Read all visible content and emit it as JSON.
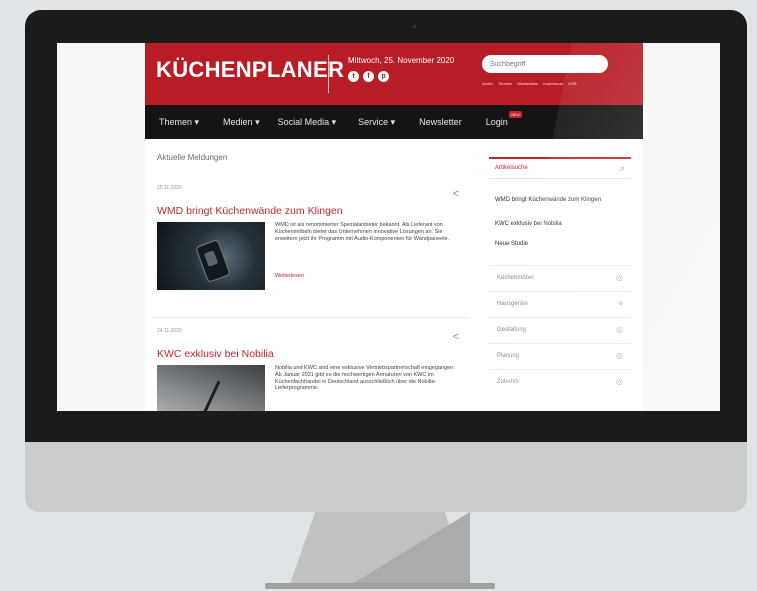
{
  "site": {
    "logo": "KÜCHENPLANER",
    "date": "Mittwoch, 25. November 2020",
    "social_icons": [
      "twitter-icon",
      "facebook-icon",
      "pinterest-icon"
    ],
    "search_placeholder": "Suchbegriff",
    "header_links": [
      "Archiv",
      "Termine",
      "Mediadaten",
      "Impressum",
      "AGB"
    ],
    "nav": [
      {
        "label": "Themen ▾"
      },
      {
        "label": "Medien ▾"
      },
      {
        "label": "Social Media ▾"
      },
      {
        "label": "Service ▾"
      },
      {
        "label": "Newsletter"
      },
      {
        "label": "Login",
        "badge": "NEU"
      }
    ]
  },
  "main": {
    "section_title": "Aktuelle Meldungen",
    "articles": [
      {
        "date": "25.11.2020",
        "title": "WMD bringt Küchenwände zum Klingen",
        "text": "WMD ist als renommierter Spezialanbieter bekannt. Als Lieferant von Küchenmöbeln bietet das Unternehmen innovative Lösungen an. Sie erweitern jetzt ihr Programm mit Audio-Komponenten für Wandpaneele.",
        "read_more": "Weiterlesen"
      },
      {
        "date": "24.11.2020",
        "title": "KWC exklusiv bei Nobilia",
        "text": "Nobilia und KWC sind eine exklusive Vertriebspartnerschaft eingegangen. Ab Januar 2021 gibt es die hochwertigen Armaturen von KWC im Küchenfachhandel in Deutschland ausschließlich über die Nobilia-Lieferprogramme.",
        "read_more": ""
      }
    ]
  },
  "sidebar": {
    "search_label": "Artikelsuche",
    "links": [
      "WMD bringt Küchenwände zum Klingen",
      "KWC exklusiv bei Nobilia",
      "Neue Studie"
    ],
    "categories": [
      "Küchenmöbel",
      "Hausgeräte",
      "Gestaltung",
      "Planung",
      "Zubehör"
    ]
  }
}
